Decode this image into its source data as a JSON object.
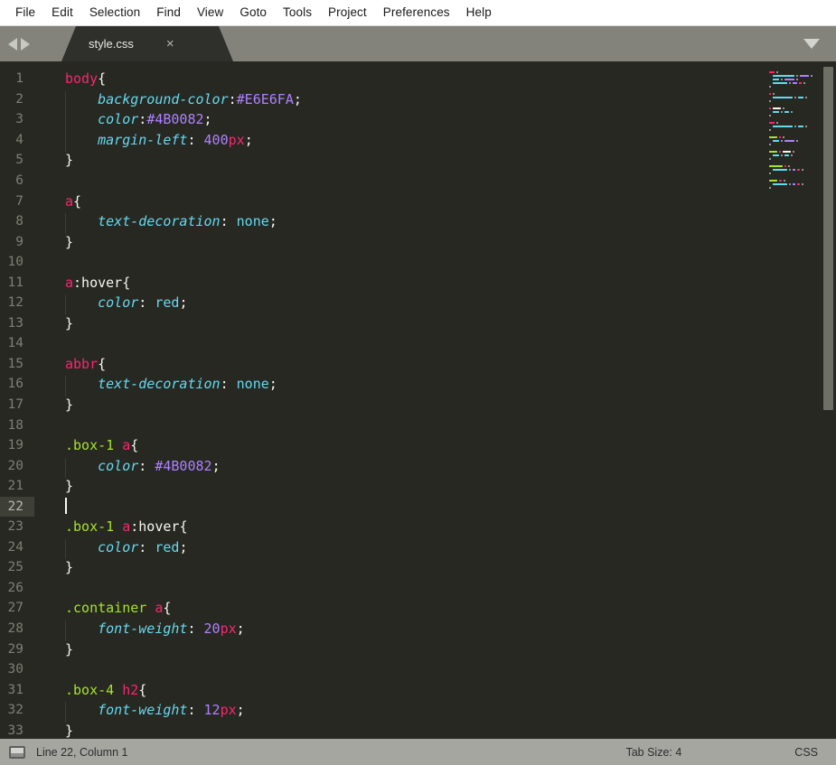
{
  "menubar": {
    "items": [
      {
        "label": "File"
      },
      {
        "label": "Edit"
      },
      {
        "label": "Selection"
      },
      {
        "label": "Find"
      },
      {
        "label": "View"
      },
      {
        "label": "Goto"
      },
      {
        "label": "Tools"
      },
      {
        "label": "Project"
      },
      {
        "label": "Preferences"
      },
      {
        "label": "Help"
      }
    ]
  },
  "tabbar": {
    "nav_back_icon": "triangle-left-icon",
    "nav_forward_icon": "triangle-right-icon",
    "dropdown_icon": "chevron-down-icon",
    "tabs": [
      {
        "label": "style.css",
        "close_label": "×",
        "active": true
      }
    ]
  },
  "editor": {
    "active_line": 22,
    "cursor_column": 1,
    "lines": [
      {
        "num": 1,
        "indent": false,
        "tokens": [
          {
            "t": "body",
            "c": "t-sel"
          },
          {
            "t": "{",
            "c": "t-punct"
          }
        ]
      },
      {
        "num": 2,
        "indent": true,
        "tokens": [
          {
            "t": "    ",
            "c": "t-punct"
          },
          {
            "t": "background-color",
            "c": "t-prop"
          },
          {
            "t": ":",
            "c": "t-punct"
          },
          {
            "t": "#E6E6FA",
            "c": "t-hex"
          },
          {
            "t": ";",
            "c": "t-punct"
          }
        ]
      },
      {
        "num": 3,
        "indent": true,
        "tokens": [
          {
            "t": "    ",
            "c": "t-punct"
          },
          {
            "t": "color",
            "c": "t-prop"
          },
          {
            "t": ":",
            "c": "t-punct"
          },
          {
            "t": "#4B0082",
            "c": "t-hex"
          },
          {
            "t": ";",
            "c": "t-punct"
          }
        ]
      },
      {
        "num": 4,
        "indent": true,
        "tokens": [
          {
            "t": "    ",
            "c": "t-punct"
          },
          {
            "t": "margin-left",
            "c": "t-prop"
          },
          {
            "t": ": ",
            "c": "t-punct"
          },
          {
            "t": "400",
            "c": "t-num"
          },
          {
            "t": "px",
            "c": "t-unit"
          },
          {
            "t": ";",
            "c": "t-punct"
          }
        ]
      },
      {
        "num": 5,
        "indent": false,
        "tokens": [
          {
            "t": "}",
            "c": "t-punct"
          }
        ]
      },
      {
        "num": 6,
        "indent": false,
        "tokens": []
      },
      {
        "num": 7,
        "indent": false,
        "tokens": [
          {
            "t": "a",
            "c": "t-sel"
          },
          {
            "t": "{",
            "c": "t-punct"
          }
        ]
      },
      {
        "num": 8,
        "indent": true,
        "tokens": [
          {
            "t": "    ",
            "c": "t-punct"
          },
          {
            "t": "text-decoration",
            "c": "t-prop"
          },
          {
            "t": ": ",
            "c": "t-punct"
          },
          {
            "t": "none",
            "c": "t-kw"
          },
          {
            "t": ";",
            "c": "t-punct"
          }
        ]
      },
      {
        "num": 9,
        "indent": false,
        "tokens": [
          {
            "t": "}",
            "c": "t-punct"
          }
        ]
      },
      {
        "num": 10,
        "indent": false,
        "tokens": []
      },
      {
        "num": 11,
        "indent": false,
        "tokens": [
          {
            "t": "a",
            "c": "t-sel"
          },
          {
            "t": ":hover",
            "c": "t-pseudo"
          },
          {
            "t": "{",
            "c": "t-punct"
          }
        ]
      },
      {
        "num": 12,
        "indent": true,
        "tokens": [
          {
            "t": "    ",
            "c": "t-punct"
          },
          {
            "t": "color",
            "c": "t-prop"
          },
          {
            "t": ": ",
            "c": "t-punct"
          },
          {
            "t": "red",
            "c": "t-kw"
          },
          {
            "t": ";",
            "c": "t-punct"
          }
        ]
      },
      {
        "num": 13,
        "indent": false,
        "tokens": [
          {
            "t": "}",
            "c": "t-punct"
          }
        ]
      },
      {
        "num": 14,
        "indent": false,
        "tokens": []
      },
      {
        "num": 15,
        "indent": false,
        "tokens": [
          {
            "t": "abbr",
            "c": "t-sel"
          },
          {
            "t": "{",
            "c": "t-punct"
          }
        ]
      },
      {
        "num": 16,
        "indent": true,
        "tokens": [
          {
            "t": "    ",
            "c": "t-punct"
          },
          {
            "t": "text-decoration",
            "c": "t-prop"
          },
          {
            "t": ": ",
            "c": "t-punct"
          },
          {
            "t": "none",
            "c": "t-kw"
          },
          {
            "t": ";",
            "c": "t-punct"
          }
        ]
      },
      {
        "num": 17,
        "indent": false,
        "tokens": [
          {
            "t": "}",
            "c": "t-punct"
          }
        ]
      },
      {
        "num": 18,
        "indent": false,
        "tokens": []
      },
      {
        "num": 19,
        "indent": false,
        "tokens": [
          {
            "t": ".box-1 ",
            "c": "t-class"
          },
          {
            "t": "a",
            "c": "t-sel"
          },
          {
            "t": "{",
            "c": "t-punct"
          }
        ]
      },
      {
        "num": 20,
        "indent": true,
        "tokens": [
          {
            "t": "    ",
            "c": "t-punct"
          },
          {
            "t": "color",
            "c": "t-prop"
          },
          {
            "t": ": ",
            "c": "t-punct"
          },
          {
            "t": "#4B0082",
            "c": "t-hex"
          },
          {
            "t": ";",
            "c": "t-punct"
          }
        ]
      },
      {
        "num": 21,
        "indent": false,
        "tokens": [
          {
            "t": "}",
            "c": "t-punct"
          }
        ]
      },
      {
        "num": 22,
        "indent": false,
        "tokens": [],
        "cursor": true
      },
      {
        "num": 23,
        "indent": false,
        "tokens": [
          {
            "t": ".box-1 ",
            "c": "t-class"
          },
          {
            "t": "a",
            "c": "t-sel"
          },
          {
            "t": ":hover",
            "c": "t-pseudo"
          },
          {
            "t": "{",
            "c": "t-punct"
          }
        ]
      },
      {
        "num": 24,
        "indent": true,
        "tokens": [
          {
            "t": "    ",
            "c": "t-punct"
          },
          {
            "t": "color",
            "c": "t-prop"
          },
          {
            "t": ": ",
            "c": "t-punct"
          },
          {
            "t": "red",
            "c": "t-kw"
          },
          {
            "t": ";",
            "c": "t-punct"
          }
        ]
      },
      {
        "num": 25,
        "indent": false,
        "tokens": [
          {
            "t": "}",
            "c": "t-punct"
          }
        ]
      },
      {
        "num": 26,
        "indent": false,
        "tokens": []
      },
      {
        "num": 27,
        "indent": false,
        "tokens": [
          {
            "t": ".container ",
            "c": "t-class"
          },
          {
            "t": "a",
            "c": "t-sel"
          },
          {
            "t": "{",
            "c": "t-punct"
          }
        ]
      },
      {
        "num": 28,
        "indent": true,
        "tokens": [
          {
            "t": "    ",
            "c": "t-punct"
          },
          {
            "t": "font-weight",
            "c": "t-prop"
          },
          {
            "t": ": ",
            "c": "t-punct"
          },
          {
            "t": "20",
            "c": "t-num"
          },
          {
            "t": "px",
            "c": "t-unit"
          },
          {
            "t": ";",
            "c": "t-punct"
          }
        ]
      },
      {
        "num": 29,
        "indent": false,
        "tokens": [
          {
            "t": "}",
            "c": "t-punct"
          }
        ]
      },
      {
        "num": 30,
        "indent": false,
        "tokens": []
      },
      {
        "num": 31,
        "indent": false,
        "tokens": [
          {
            "t": ".box-4 ",
            "c": "t-class"
          },
          {
            "t": "h2",
            "c": "t-sel"
          },
          {
            "t": "{",
            "c": "t-punct"
          }
        ]
      },
      {
        "num": 32,
        "indent": true,
        "tokens": [
          {
            "t": "    ",
            "c": "t-punct"
          },
          {
            "t": "font-weight",
            "c": "t-prop"
          },
          {
            "t": ": ",
            "c": "t-punct"
          },
          {
            "t": "12",
            "c": "t-num"
          },
          {
            "t": "px",
            "c": "t-unit"
          },
          {
            "t": ";",
            "c": "t-punct"
          }
        ]
      },
      {
        "num": 33,
        "indent": false,
        "tokens": [
          {
            "t": "}",
            "c": "t-punct"
          }
        ]
      }
    ]
  },
  "statusbar": {
    "screen_icon": "monitor-icon",
    "position": "Line 22, Column 1",
    "tab_size": "Tab Size: 4",
    "syntax": "CSS"
  },
  "colors": {
    "editor_bg": "#272822",
    "menubar_bg": "#FFFFFF",
    "tabbar_bg": "#83837C",
    "tab_active_bg": "#2F2F2B",
    "statusbar_bg": "#A6A6A1",
    "selector": "#F92672",
    "class_selector": "#A6E22E",
    "property": "#66D9EF",
    "value_hex": "#AE81FF",
    "unit": "#F92672",
    "keyword": "#66D9EF",
    "punctuation": "#F8F8F2",
    "line_number": "#7D7F73",
    "active_line_gutter": "#3E4038"
  }
}
